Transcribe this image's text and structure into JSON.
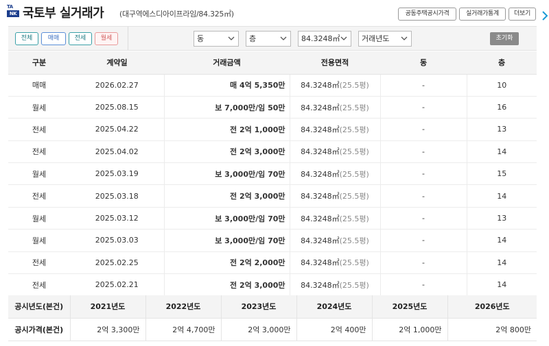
{
  "header": {
    "logo_top": "TA",
    "logo_bottom": "NK",
    "title": "국토부 실거래가",
    "subtitle": "(대구역에스디아이프라임/84.325㎡)",
    "buttons": [
      "공동주택공시가격",
      "실거래가통계",
      "더보기"
    ]
  },
  "filters": {
    "type_tabs": [
      "전체",
      "매매",
      "전세",
      "월세"
    ],
    "selected_tab": "월세",
    "selects": [
      "동",
      "층",
      "84.3248㎡",
      "거래년도"
    ],
    "reset_label": "초기화"
  },
  "table": {
    "columns": [
      "구분",
      "계약일",
      "거래금액",
      "전용면적",
      "동",
      "층"
    ],
    "rows": [
      {
        "type": "매매",
        "date": "2026.02.27",
        "amount": "매 4억 5,350만",
        "kind": "sale",
        "area": "84.3248㎡",
        "pyeong": "(25.5평)",
        "dong": "-",
        "floor": "10"
      },
      {
        "type": "월세",
        "date": "2025.08.15",
        "amount": "보 7,000만/임 50만",
        "kind": "wol",
        "area": "84.3248㎡",
        "pyeong": "(25.5평)",
        "dong": "-",
        "floor": "16"
      },
      {
        "type": "전세",
        "date": "2025.04.22",
        "amount": "전 2억 1,000만",
        "kind": "jeon",
        "area": "84.3248㎡",
        "pyeong": "(25.5평)",
        "dong": "-",
        "floor": "13"
      },
      {
        "type": "전세",
        "date": "2025.04.02",
        "amount": "전 2억 3,000만",
        "kind": "jeon",
        "area": "84.3248㎡",
        "pyeong": "(25.5평)",
        "dong": "-",
        "floor": "14"
      },
      {
        "type": "월세",
        "date": "2025.03.19",
        "amount": "보 3,000만/임 70만",
        "kind": "wol",
        "area": "84.3248㎡",
        "pyeong": "(25.5평)",
        "dong": "-",
        "floor": "15"
      },
      {
        "type": "전세",
        "date": "2025.03.18",
        "amount": "전 2억 3,000만",
        "kind": "jeon",
        "area": "84.3248㎡",
        "pyeong": "(25.5평)",
        "dong": "-",
        "floor": "14"
      },
      {
        "type": "월세",
        "date": "2025.03.12",
        "amount": "보 3,000만/임 70만",
        "kind": "wol",
        "area": "84.3248㎡",
        "pyeong": "(25.5평)",
        "dong": "-",
        "floor": "13"
      },
      {
        "type": "월세",
        "date": "2025.03.03",
        "amount": "보 3,000만/임 70만",
        "kind": "wol",
        "area": "84.3248㎡",
        "pyeong": "(25.5평)",
        "dong": "-",
        "floor": "14"
      },
      {
        "type": "전세",
        "date": "2025.02.25",
        "amount": "전 2억 2,000만",
        "kind": "jeon",
        "area": "84.3248㎡",
        "pyeong": "(25.5평)",
        "dong": "-",
        "floor": "14"
      },
      {
        "type": "전세",
        "date": "2025.02.21",
        "amount": "전 2억 3,000만",
        "kind": "jeon",
        "area": "84.3248㎡",
        "pyeong": "(25.5평)",
        "dong": "-",
        "floor": "14"
      }
    ]
  },
  "public_price": {
    "year_label": "공시년도(본건)",
    "price_label": "공시가격(본건)",
    "years": [
      "2021년도",
      "2022년도",
      "2023년도",
      "2024년도",
      "2025년도",
      "2026년도"
    ],
    "prices": [
      "2억 3,300만",
      "2억 4,700만",
      "2억 3,000만",
      "2억 400만",
      "2억 1,000만",
      "2억 800만"
    ]
  },
  "colors": {
    "sale": "#2d4fd9",
    "jeon": "#22a13a",
    "wol": "#e8603a",
    "brand": "#1b3d8c"
  }
}
